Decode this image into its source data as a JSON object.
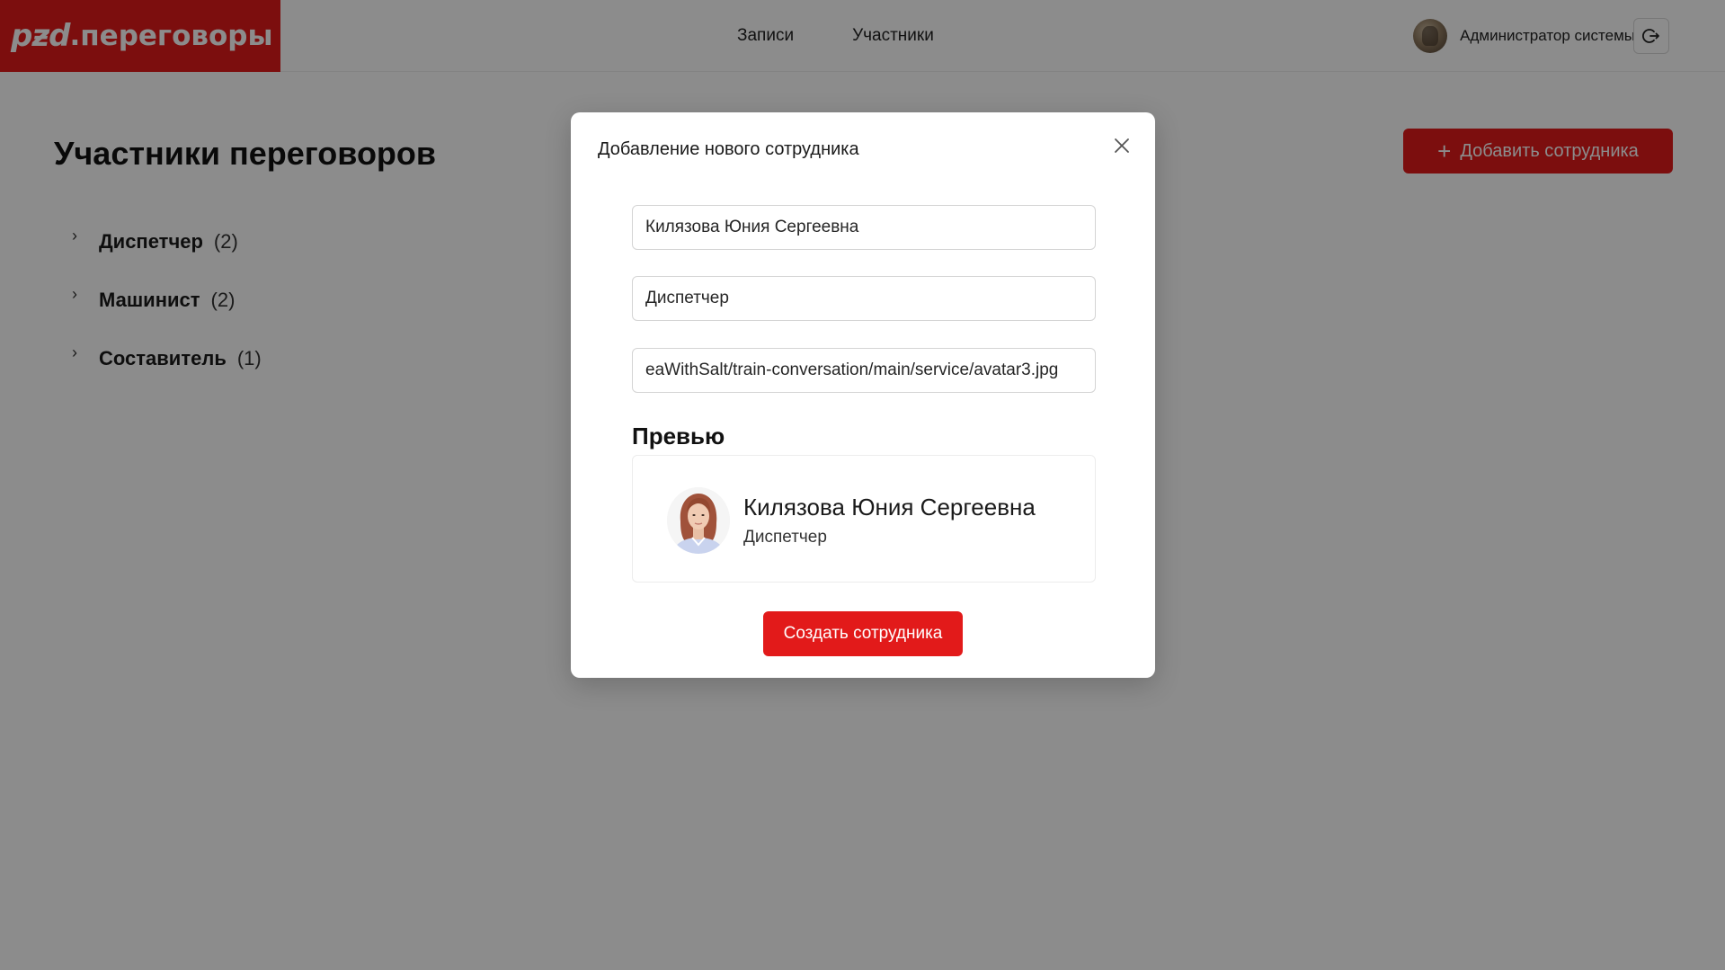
{
  "header": {
    "logo_mark": "pƶd",
    "logo_text": ".переговоры",
    "nav": [
      {
        "label": "Записи"
      },
      {
        "label": "Участники"
      }
    ],
    "user_name": "Администратор системы"
  },
  "page": {
    "title": "Участники переговоров",
    "add_button": "Добавить сотрудника",
    "groups": [
      {
        "name": "Диспетчер",
        "count": "(2)"
      },
      {
        "name": "Машинист",
        "count": "(2)"
      },
      {
        "name": "Составитель",
        "count": "(1)"
      }
    ]
  },
  "modal": {
    "title": "Добавление нового сотрудника",
    "fields": {
      "name_value": "Килязова Юния Сергеевна",
      "role_value": "Диспетчер",
      "avatar_url_value": "eaWithSalt/train-conversation/main/service/avatar3.jpg"
    },
    "preview_title": "Превью",
    "preview": {
      "name": "Килязова Юния Сергеевна",
      "role": "Диспетчер"
    },
    "create_button": "Создать сотрудника"
  },
  "colors": {
    "brand_red": "#e21a1a",
    "overlay": "rgba(0,0,0,0.45)"
  }
}
